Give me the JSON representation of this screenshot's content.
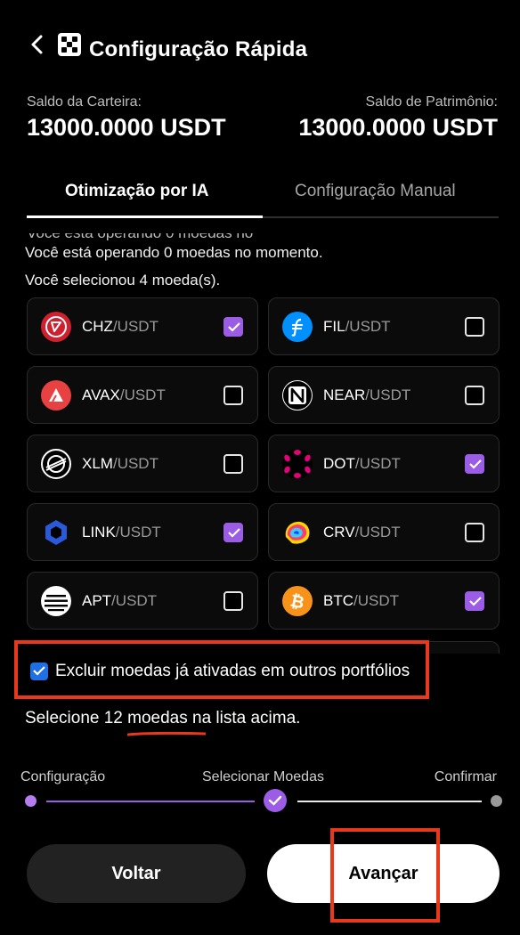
{
  "header": {
    "title": "Configuração Rápida",
    "back_icon": "chevron-left-icon",
    "logo_icon": "dice-logo-icon"
  },
  "balances": {
    "wallet_label": "Saldo da Carteira:",
    "wallet_value": "13000.0000 USDT",
    "equity_label": "Saldo de Patrimônio:",
    "equity_value": "13000.0000 USDT"
  },
  "tabs": [
    {
      "label": "Otimização por IA",
      "active": true
    },
    {
      "label": "Configuração Manual",
      "active": false
    }
  ],
  "info": {
    "operating": "Você está operando 0 moedas no momento.",
    "selected": "Você selecionou 4 moeda(s)."
  },
  "coins": [
    {
      "base": "CHZ",
      "quote": "/USDT",
      "checked": true
    },
    {
      "base": "FIL",
      "quote": "/USDT",
      "checked": false
    },
    {
      "base": "AVAX",
      "quote": "/USDT",
      "checked": false
    },
    {
      "base": "NEAR",
      "quote": "/USDT",
      "checked": false
    },
    {
      "base": "XLM",
      "quote": "/USDT",
      "checked": false
    },
    {
      "base": "DOT",
      "quote": "/USDT",
      "checked": true
    },
    {
      "base": "LINK",
      "quote": "/USDT",
      "checked": true
    },
    {
      "base": "CRV",
      "quote": "/USDT",
      "checked": false
    },
    {
      "base": "APT",
      "quote": "/USDT",
      "checked": false
    },
    {
      "base": "BTC",
      "quote": "/USDT",
      "checked": true
    }
  ],
  "exclude": {
    "label": "Excluir moedas já ativadas em outros portfólios",
    "checked": true
  },
  "select_prompt": "Selecione 12 moedas na lista acima.",
  "steps": [
    {
      "label": "Configuração"
    },
    {
      "label": "Selecionar Moedas"
    },
    {
      "label": "Confirmar"
    }
  ],
  "buttons": {
    "back": "Voltar",
    "next": "Avançar"
  },
  "colors": {
    "accent_purple": "#9b5de5",
    "check_blue": "#1f6fe5",
    "highlight_red": "#e8391c"
  }
}
